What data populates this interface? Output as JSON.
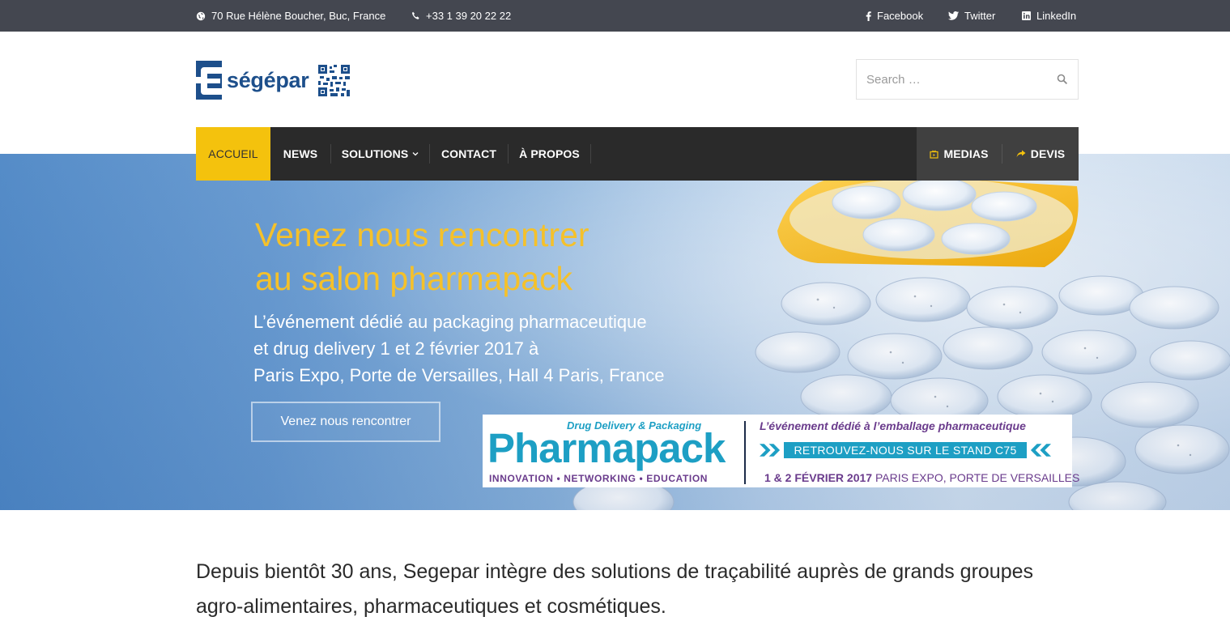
{
  "topbar": {
    "address": "70 Rue Hélène Boucher, Buc, France",
    "phone": "+33 1 39 20 22 22",
    "social": [
      {
        "label": "Facebook",
        "icon": "facebook-icon"
      },
      {
        "label": "Twitter",
        "icon": "twitter-icon"
      },
      {
        "label": "LinkedIn",
        "icon": "linkedin-icon"
      }
    ]
  },
  "brand": {
    "name": "ségépar",
    "color": "#1d4f8b"
  },
  "search": {
    "placeholder": "Search …"
  },
  "nav": {
    "items": [
      {
        "label": "ACCUEIL",
        "active": true
      },
      {
        "label": "NEWS"
      },
      {
        "label": "SOLUTIONS",
        "has_dropdown": true
      },
      {
        "label": "CONTACT"
      },
      {
        "label": "À PROPOS"
      }
    ],
    "right": [
      {
        "label": "MEDIAS",
        "icon": "media-icon"
      },
      {
        "label": "DEVIS",
        "icon": "share-arrow-icon"
      }
    ],
    "accent": "#f4c20d"
  },
  "hero": {
    "title": "Venez nous rencontrer\nau salon pharmapack",
    "subtitle": "L’événement dédié au packaging pharmaceutique\net drug delivery 1 et 2 février 2017 à\nParis Expo, Porte de Versailles, Hall 4 Paris, France",
    "button": "Venez nous rencontrer",
    "banner": {
      "top": "Drug Delivery & Packaging",
      "logo": "Pharmapack",
      "tagline": "INNOVATION • NETWORKING • EDUCATION",
      "headline": "L’événement dédié à l’emballage pharmaceutique",
      "stand": "RETROUVEZ-NOUS SUR LE STAND C75",
      "date_bold": "1 & 2 FÉVRIER 2017",
      "date_rest": " PARIS EXPO, PORTE DE VERSAILLES"
    }
  },
  "intro": "Depuis bientôt 30 ans, Segepar intègre des solutions de traçabilité auprès de grands groupes agro-alimentaires, pharmaceutiques et cosmétiques."
}
